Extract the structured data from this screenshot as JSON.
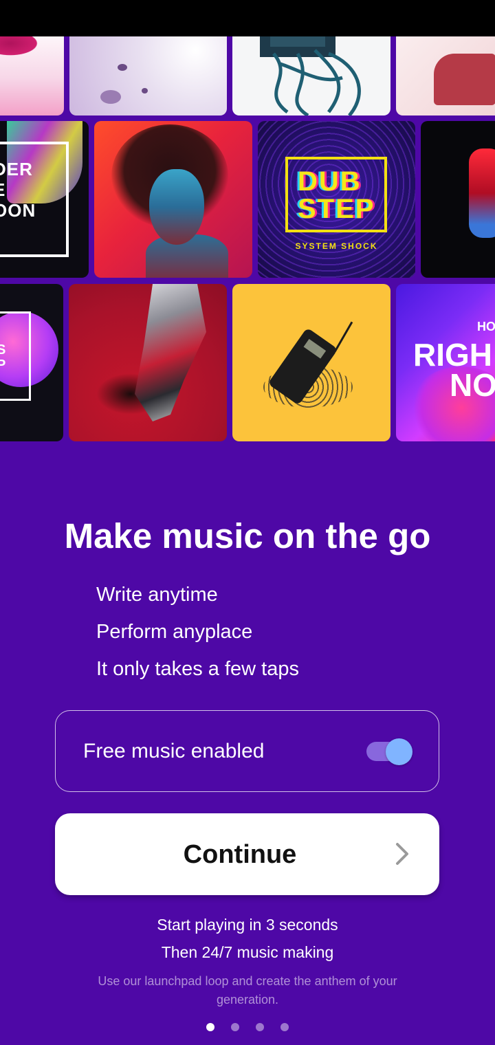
{
  "album_grid": {
    "row2": {
      "tile1_text": "DER\nE\nOON",
      "tile3_main": "DUB\nSTEP",
      "tile3_sub": "SYSTEM SHOCK"
    },
    "row3": {
      "tile1_text": "S\nP",
      "tile4_top": "HO",
      "tile4_line1": "RIGH",
      "tile4_line2": "NO"
    }
  },
  "onboarding": {
    "title": "Make music on the go",
    "features": [
      "Write anytime",
      "Perform anyplace",
      "It only takes a few taps"
    ],
    "toggle": {
      "label": "Free music enabled",
      "enabled": true
    },
    "continue_label": "Continue",
    "subtitle_1": "Start playing in 3 seconds",
    "subtitle_2": "Then 24/7 music making",
    "fine_print": "Use our launchpad loop and create the anthem of your generation.",
    "page_indicator": {
      "total": 4,
      "active": 0
    }
  },
  "colors": {
    "background": "#4e08a6",
    "toggle_thumb": "#80b4ff",
    "toggle_track": "#8867dd",
    "button_bg": "#ffffff"
  },
  "icons": {
    "continue": "chevron-right-icon"
  }
}
